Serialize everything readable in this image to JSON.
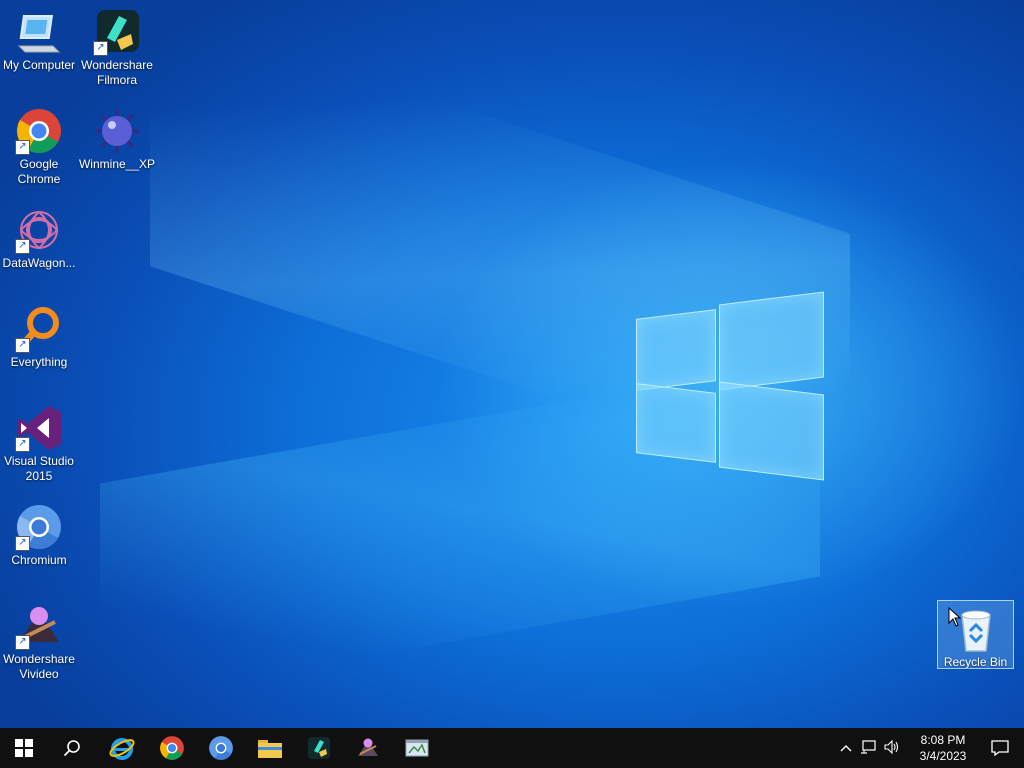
{
  "desktop": {
    "icons": [
      {
        "label": "My Computer",
        "icon": "computer-icon"
      },
      {
        "label": "Wondershare Filmora",
        "icon": "filmora-icon"
      },
      {
        "label": "Google Chrome",
        "icon": "chrome-icon"
      },
      {
        "label": "Winmine__XP",
        "icon": "mine-icon"
      },
      {
        "label": "DataWagon...",
        "icon": "datawagon-icon"
      },
      {
        "label": "Everything",
        "icon": "everything-icon"
      },
      {
        "label": "Visual Studio 2015",
        "icon": "visual-studio-icon"
      },
      {
        "label": "Chromium",
        "icon": "chromium-icon"
      },
      {
        "label": "Wondershare Vivideo",
        "icon": "vivideo-icon"
      }
    ],
    "recycle_bin": {
      "label": "Recycle Bin",
      "icon": "recycle-bin-icon"
    }
  },
  "taskbar": {
    "pinned": [
      {
        "name": "start",
        "icon": "windows-start-icon"
      },
      {
        "name": "search",
        "icon": "search-icon"
      },
      {
        "name": "internet-explorer",
        "icon": "internet-explorer-icon"
      },
      {
        "name": "chrome",
        "icon": "chrome-icon"
      },
      {
        "name": "chromium",
        "icon": "chromium-icon"
      },
      {
        "name": "file-explorer",
        "icon": "folder-icon"
      },
      {
        "name": "filmora",
        "icon": "filmora-icon"
      },
      {
        "name": "vivideo",
        "icon": "vivideo-icon"
      },
      {
        "name": "app",
        "icon": "app-window-icon"
      }
    ],
    "clock": {
      "time": "8:08 PM",
      "date": "3/4/2023"
    }
  },
  "colors": {
    "desktop_blue": "#0d6fd8",
    "taskbar": "#101010",
    "accent": "#38a3f0"
  }
}
